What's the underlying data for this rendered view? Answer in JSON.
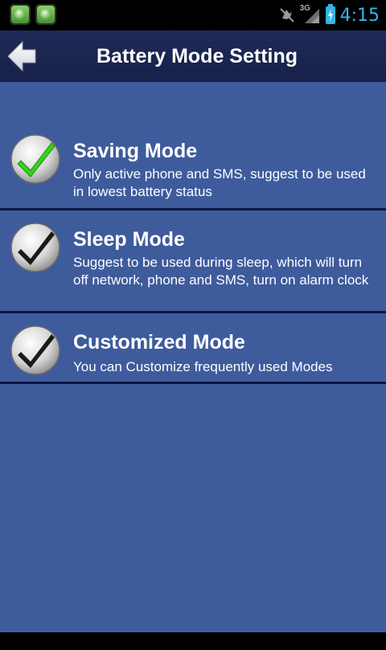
{
  "status_bar": {
    "time": "4:15",
    "network_label": "3G",
    "icons": [
      "app-notification-icon",
      "app-notification-icon",
      "mute-icon",
      "signal-icon",
      "battery-charging-icon"
    ]
  },
  "header": {
    "title": "Battery Mode Setting",
    "back_icon": "back-arrow-icon"
  },
  "modes": [
    {
      "label": "Saving Mode",
      "description": "Only active phone and SMS, suggest to be used in lowest battery status",
      "selected": true
    },
    {
      "label": "Sleep Mode",
      "description": "Suggest to be used during sleep, which will turn off network, phone and SMS, turn on alarm clock",
      "selected": false
    },
    {
      "label": "Customized Mode",
      "description": "You can Customize frequently used Modes",
      "selected": false
    }
  ],
  "colors": {
    "content_bg": "#3e5b9c",
    "title_bar_bg": "#1e2a57",
    "accent_green": "#35d11e",
    "clock_blue": "#33b5e5"
  }
}
